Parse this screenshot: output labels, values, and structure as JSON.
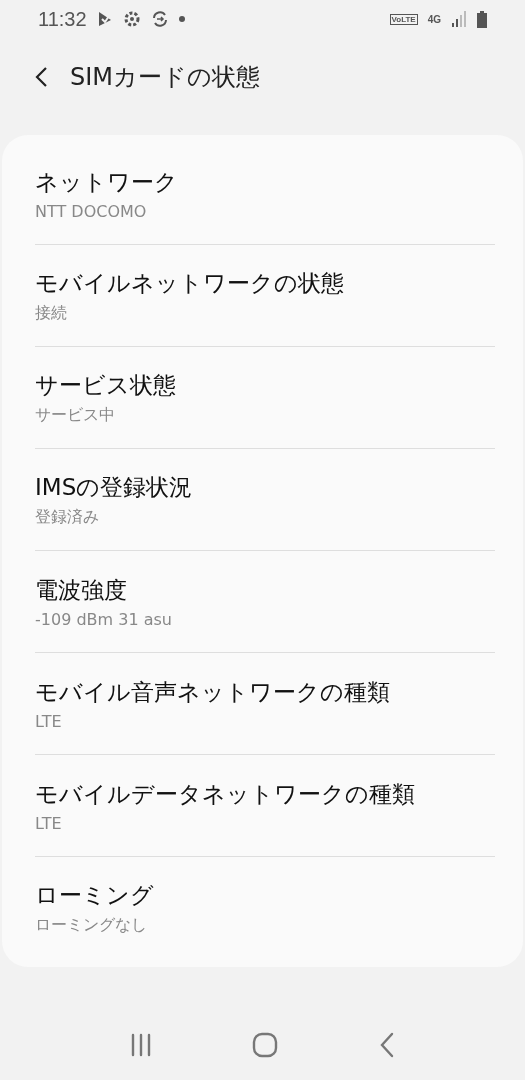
{
  "status_bar": {
    "time": "11:32",
    "volte": "VoLTE",
    "network": "4G"
  },
  "header": {
    "title": "SIMカードの状態"
  },
  "items": [
    {
      "title": "ネットワーク",
      "value": "NTT DOCOMO"
    },
    {
      "title": "モバイルネットワークの状態",
      "value": "接続"
    },
    {
      "title": "サービス状態",
      "value": "サービス中"
    },
    {
      "title": "IMSの登録状況",
      "value": "登録済み"
    },
    {
      "title": "電波強度",
      "value": "-109 dBm 31 asu"
    },
    {
      "title": "モバイル音声ネットワークの種類",
      "value": "LTE"
    },
    {
      "title": "モバイルデータネットワークの種類",
      "value": "LTE"
    },
    {
      "title": "ローミング",
      "value": "ローミングなし"
    }
  ]
}
